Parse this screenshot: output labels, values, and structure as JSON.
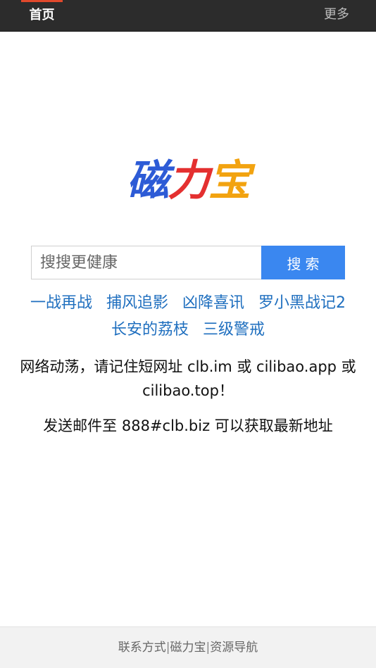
{
  "nav": {
    "home_label": "首页",
    "more_label": "更多"
  },
  "logo": {
    "char1": "磁",
    "char2": "力",
    "char3": "宝"
  },
  "search": {
    "placeholder": "搜搜更健康",
    "button_label": "搜索"
  },
  "hot_keywords": [
    "一战再战",
    "捕风追影",
    "凶降喜讯",
    "罗小黑战记2",
    "长安的荔枝",
    "三级警戒"
  ],
  "notices": {
    "line1": "网络动荡，请记住短网址 clb.im 或 cilibao.app 或 cilibao.top！",
    "line2": "发送邮件至 888#clb.biz 可以获取最新地址"
  },
  "footer": {
    "links": [
      "联系方式",
      "磁力宝",
      "资源导航"
    ],
    "separator": "|"
  },
  "colors": {
    "navbar_bg": "#2c2c2c",
    "nav_accent": "#e0492c",
    "logo_blue": "#2d5bd6",
    "logo_red": "#e43030",
    "logo_orange": "#f2a310",
    "search_button": "#3a87f0",
    "link": "#1f6fbf"
  }
}
